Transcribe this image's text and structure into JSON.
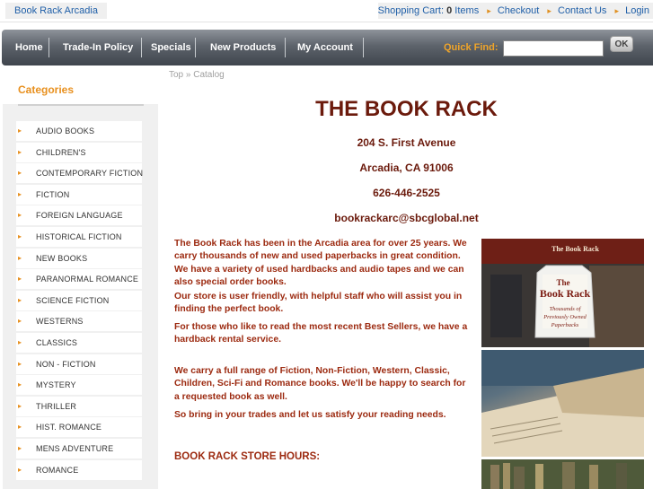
{
  "topbar": {
    "store_name": "Book Rack Arcadia",
    "cart_label": "Shopping Cart:",
    "cart_count": "0",
    "cart_items": "Items",
    "checkout": "Checkout",
    "contact": "Contact Us",
    "login": "Login"
  },
  "nav": {
    "items": [
      "Home",
      "Trade-In Policy",
      "Specials",
      "New Products",
      "My Account"
    ],
    "quick_find": "Quick Find:",
    "ok": "OK",
    "search_value": ""
  },
  "sidebar": {
    "title": "Categories",
    "categories": [
      "AUDIO BOOKS",
      "CHILDREN'S",
      "CONTEMPORARY FICTION",
      "FICTION",
      "FOREIGN LANGUAGE",
      "HISTORICAL FICTION",
      "NEW BOOKS",
      "PARANORMAL ROMANCE",
      "SCIENCE FICTION",
      "WESTERNS",
      "CLASSICS",
      "NON - FICTION",
      "MYSTERY",
      "THRILLER",
      "HIST. ROMANCE",
      "MENS ADVENTURE",
      "ROMANCE"
    ]
  },
  "breadcrumb": {
    "top": "Top",
    "sep": "»",
    "catalog": "Catalog"
  },
  "store": {
    "name": "THE BOOK RACK",
    "street": "204 S. First Avenue",
    "city": "Arcadia, CA 91006",
    "phone": "626-446-2525",
    "email": "bookrackarc@sbcglobal.net"
  },
  "content": {
    "p1": "The Book Rack has been in the Arcadia area for over 25 years. We carry thousands of new and used paperbacks in great condition. We have a variety of used hardbacks and audio tapes and we can also special order books.",
    "p2": "Our store is user friendly, with helpful staff who will assist you in finding the perfect book.",
    "p3": "For those who like to read the most recent Best Sellers, we have a hardback rental service.",
    "p4": "We carry a full range of Fiction, Non-Fiction, Western, Classic, Children, Sci-Fi and Romance books. We'll be happy to search for a requested book as well.",
    "p5": "So bring in your trades and let us satisfy your reading needs.",
    "hours_heading": "BOOK RACK STORE HOURS:"
  },
  "photo_sign": {
    "top": "The Book Rack",
    "the": "The",
    "name": "Book Rack",
    "sub1": "Thousands of",
    "sub2": "Previously Owned",
    "sub3": "Paperbacks"
  }
}
